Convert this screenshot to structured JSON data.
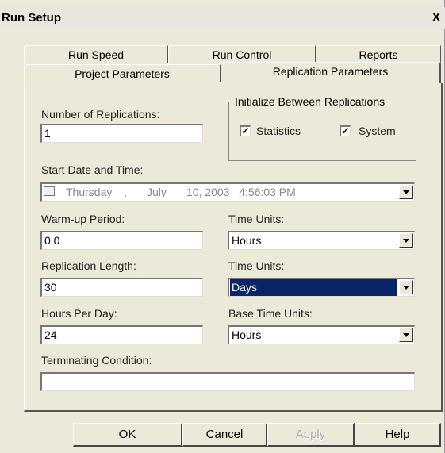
{
  "window": {
    "title": "Run Setup",
    "close_label": "X"
  },
  "tabs_row1": [
    {
      "label": "Run Speed"
    },
    {
      "label": "Run Control"
    },
    {
      "label": "Reports"
    }
  ],
  "tabs_row2": [
    {
      "label": "Project Parameters"
    },
    {
      "label": "Replication Parameters"
    }
  ],
  "form": {
    "num_replications_label": "Number of Replications:",
    "num_replications_value": "1",
    "init_group_title": "Initialize Between Replications",
    "statistics_label": "Statistics",
    "statistics_checked": "✓",
    "system_label": "System",
    "system_checked": "✓",
    "start_date_label": "Start Date and Time:",
    "start_day": "Thursday",
    "start_comma": ",",
    "start_month": "July",
    "start_datetime": "10, 2003   4:56:03 PM",
    "warmup_label": "Warm-up Period:",
    "warmup_value": "0.0",
    "warmup_units_label": "Time Units:",
    "warmup_units_value": "Hours",
    "replication_length_label": "Replication Length:",
    "replication_length_value": "30",
    "replication_units_label": "Time Units:",
    "replication_units_value": "Days",
    "hours_per_day_label": "Hours Per Day:",
    "hours_per_day_value": "24",
    "base_units_label": "Base Time Units:",
    "base_units_value": "Hours",
    "terminating_label": "Terminating Condition:",
    "terminating_value": ""
  },
  "buttons": {
    "ok": "OK",
    "cancel": "Cancel",
    "apply": "Apply",
    "help": "Help"
  }
}
